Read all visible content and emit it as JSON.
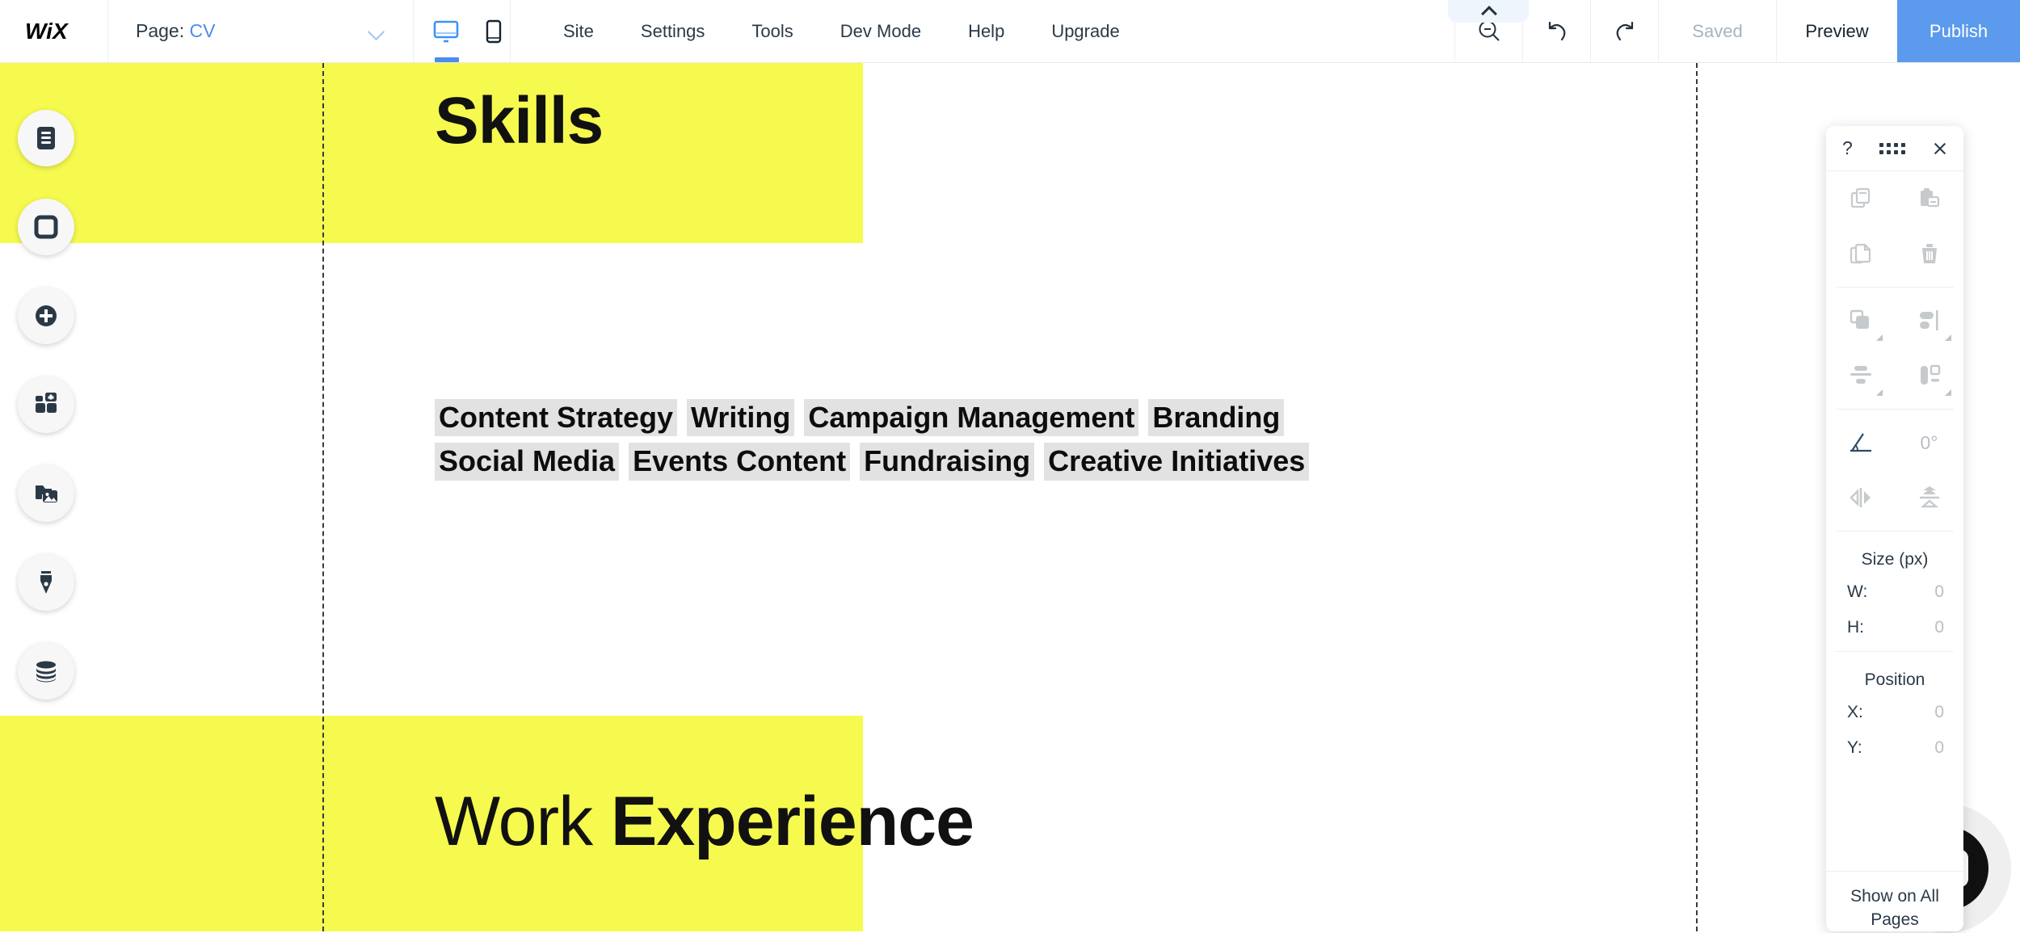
{
  "topbar": {
    "logo": "WiX",
    "page_label": "Page:",
    "page_name": "CV",
    "chevron_icon": "chevron-down-icon",
    "view_desktop_icon": "desktop-view-icon",
    "view_mobile_icon": "mobile-view-icon",
    "collapse_icon": "chevron-up-icon",
    "menu": [
      {
        "label": "Site"
      },
      {
        "label": "Settings"
      },
      {
        "label": "Tools"
      },
      {
        "label": "Dev Mode"
      },
      {
        "label": "Help"
      },
      {
        "label": "Upgrade"
      }
    ],
    "zoom_out_icon": "zoom-out-icon",
    "undo_icon": "undo-icon",
    "redo_icon": "redo-icon",
    "saved_label": "Saved",
    "preview_label": "Preview",
    "publish_label": "Publish",
    "publish_color": "#5b9aec",
    "page_accent_color": "#4a8df0"
  },
  "left_toolbar": {
    "items": [
      {
        "name": "menus-and-pages-icon",
        "title": "Menus & Pages"
      },
      {
        "name": "background-icon",
        "title": "Background"
      },
      {
        "name": "add-elements-icon",
        "title": "Add Elements"
      },
      {
        "name": "add-apps-icon",
        "title": "Add Apps"
      },
      {
        "name": "media-icon",
        "title": "Media"
      },
      {
        "name": "blog-icon",
        "title": "Blog"
      },
      {
        "name": "content-manager-icon",
        "title": "Content Manager"
      }
    ]
  },
  "canvas": {
    "section_color": "#f6fa4e",
    "skills_heading": "Skills",
    "work_heading_light": "Work ",
    "work_heading_bold": "Experience",
    "skill_tag_bg": "#e2e2e2",
    "skills_rows": [
      [
        "Content Strategy",
        "Writing",
        "Campaign Management",
        "Branding"
      ],
      [
        "Social Media",
        "Events Content",
        "Fundraising",
        "Creative Initiatives"
      ]
    ]
  },
  "panel": {
    "help_label": "?",
    "grip_icon": "drag-handle-icon",
    "close_icon": "close-icon",
    "actions": [
      {
        "name": "copy-icon",
        "label": "Copy"
      },
      {
        "name": "paste-icon",
        "label": "Paste"
      },
      {
        "name": "duplicate-icon",
        "label": "Duplicate"
      },
      {
        "name": "delete-icon",
        "label": "Delete"
      }
    ],
    "arrange": [
      {
        "name": "arrange-icon",
        "label": "Arrange"
      },
      {
        "name": "align-icon",
        "label": "Align"
      },
      {
        "name": "distribute-icon",
        "label": "Distribute"
      },
      {
        "name": "match-size-icon",
        "label": "Match Size"
      }
    ],
    "rotate_icon": "rotation-angle-icon",
    "rotation_value": "0°",
    "flip_h_icon": "flip-horizontal-icon",
    "flip_v_icon": "flip-vertical-icon",
    "size_title": "Size (px)",
    "size_fields": [
      {
        "key": "W:",
        "value": "0"
      },
      {
        "key": "H:",
        "value": "0"
      }
    ],
    "position_title": "Position",
    "position_fields": [
      {
        "key": "X:",
        "value": "0"
      },
      {
        "key": "Y:",
        "value": "0"
      }
    ],
    "show_on_all_pages": "Show on All Pages"
  },
  "chat": {
    "icon": "chat-bubble-icon",
    "color": "#111111"
  }
}
